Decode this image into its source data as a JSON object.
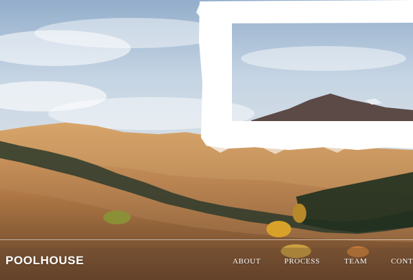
{
  "brand": {
    "logo_text": "POOLHOUSE"
  },
  "nav": {
    "items": [
      {
        "label": "ABOUT"
      },
      {
        "label": "PROCESS"
      },
      {
        "label": "TEAM"
      },
      {
        "label": "CONTACT"
      }
    ]
  },
  "colors": {
    "sky": "#c6d5e4",
    "hills": "#c48b4f",
    "brush_overlay": "#ffffff",
    "nav_text": "#ffffff"
  }
}
